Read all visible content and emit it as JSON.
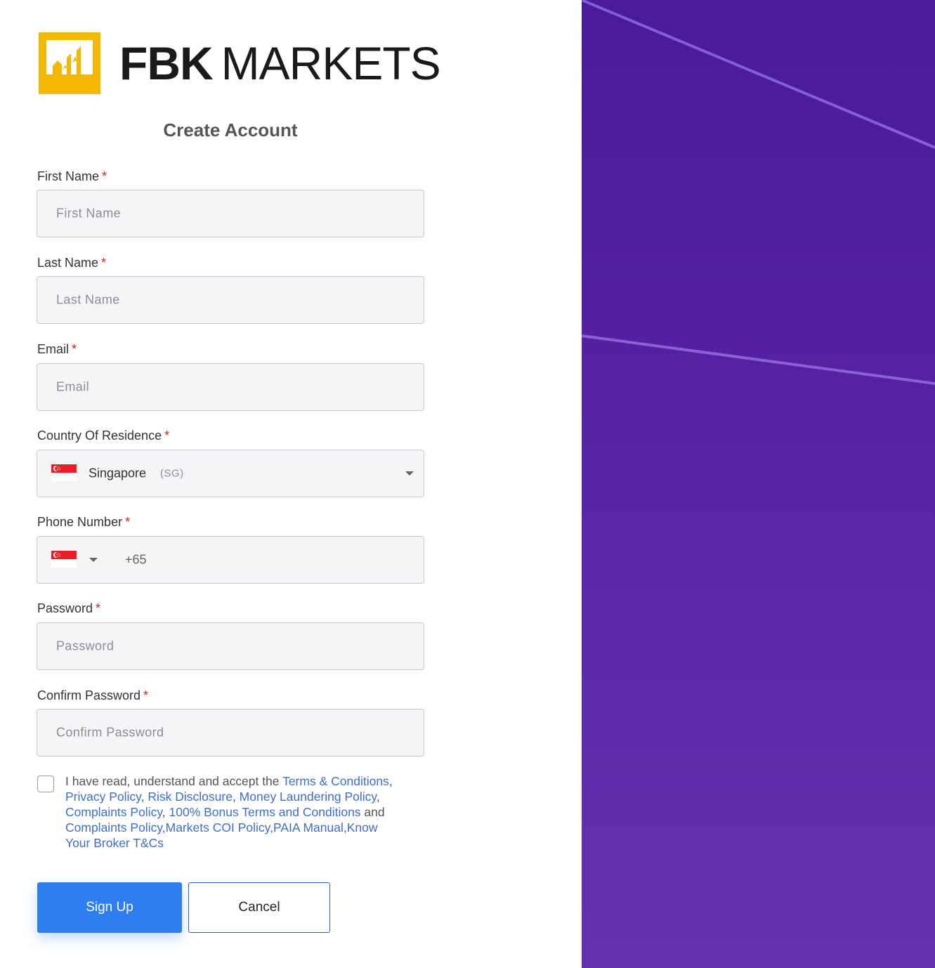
{
  "brand": {
    "name_bold": "FBK",
    "name_light": "MARKETS",
    "accent_color": "#F5B800"
  },
  "form": {
    "title": "Create Account",
    "required_marker": "*",
    "fields": {
      "first_name": {
        "label": "First Name",
        "placeholder": "First Name"
      },
      "last_name": {
        "label": "Last Name",
        "placeholder": "Last Name"
      },
      "email": {
        "label": "Email",
        "placeholder": "Email"
      },
      "country": {
        "label": "Country Of Residence",
        "selected_name": "Singapore",
        "selected_code": "(SG)",
        "flag_icon": "singapore-flag-icon"
      },
      "phone": {
        "label": "Phone Number",
        "dial_code": "+65",
        "flag_icon": "singapore-flag-icon"
      },
      "password": {
        "label": "Password",
        "placeholder": "Password"
      },
      "confirm_password": {
        "label": "Confirm Password",
        "placeholder": "Confirm Password"
      }
    },
    "agreement": {
      "checked": false,
      "text_intro": "I have read, understand and accept the ",
      "links": {
        "terms": "Terms & Conditions",
        "privacy": "Privacy Policy",
        "risk": "Risk Disclosure",
        "aml": "Money Laundering Policy",
        "complaints1": "Complaints Policy",
        "bonus": "100% Bonus Terms and Conditions",
        "complaints2": "Complaints Policy",
        "coi": "Markets COI Policy",
        "paia": "PAIA Manual",
        "kyb": "Know Your Broker T&Cs"
      },
      "sep_comma": ", ",
      "sep_and": " and ",
      "sep_tight": ","
    },
    "buttons": {
      "signup": "Sign Up",
      "cancel": "Cancel"
    }
  },
  "colors": {
    "primary_button": "#2F7EF0",
    "link": "#3F6EC9",
    "required": "#E02020",
    "right_panel": "#4A1A9C"
  }
}
